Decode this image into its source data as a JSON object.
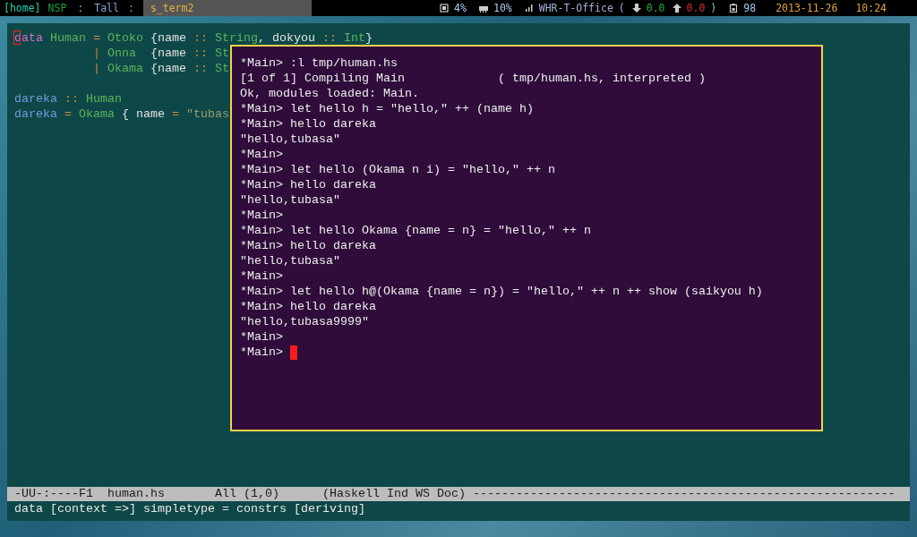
{
  "topbar": {
    "workspaces": [
      {
        "label": "[home]",
        "kind": "current"
      },
      {
        "label": "NSP",
        "kind": "hidden"
      }
    ],
    "separator_1": ":",
    "layout": "Tall",
    "separator_2": ":",
    "window_title": "s_term2",
    "status": [
      {
        "kind": "cpu",
        "text": "4%"
      },
      {
        "kind": "memory",
        "text": "10%"
      },
      {
        "kind": "wifi",
        "text": "WHR-T-Office"
      },
      {
        "kind": "paren",
        "text": "("
      },
      {
        "kind": "down",
        "text": "0.0"
      },
      {
        "kind": "up",
        "text": "0.0"
      },
      {
        "kind": "paren",
        "text": ")"
      },
      {
        "kind": "battery",
        "text": "98"
      },
      {
        "kind": "date",
        "text": "2013-11-26"
      },
      {
        "kind": "time",
        "text": "10:24"
      }
    ]
  },
  "editor": {
    "cursor_visible": true,
    "lines": [
      [
        {
          "text": "data",
          "kind": "keyword"
        },
        {
          "text": " Human",
          "kind": "type"
        },
        {
          "text": " =",
          "kind": "op"
        },
        {
          "text": " Otoko",
          "kind": "type"
        },
        {
          "text": " {name",
          "kind": "plain"
        },
        {
          "text": " ::",
          "kind": "op"
        },
        {
          "text": " String",
          "kind": "type"
        },
        {
          "text": ", dokyou",
          "kind": "plain"
        },
        {
          "text": " ::",
          "kind": "op"
        },
        {
          "text": " Int",
          "kind": "type"
        },
        {
          "text": "}",
          "kind": "plain"
        }
      ],
      [
        {
          "text": "           |",
          "kind": "op"
        },
        {
          "text": " Onna",
          "kind": "type"
        },
        {
          "text": "  {name",
          "kind": "plain"
        },
        {
          "text": " ::",
          "kind": "op"
        },
        {
          "text": " St",
          "kind": "type"
        }
      ],
      [
        {
          "text": "           |",
          "kind": "op"
        },
        {
          "text": " Okama",
          "kind": "type"
        },
        {
          "text": " {name",
          "kind": "plain"
        },
        {
          "text": " ::",
          "kind": "op"
        },
        {
          "text": " St",
          "kind": "type"
        }
      ],
      [
        {
          "text": "dareka",
          "kind": "func",
          "gap_before": true
        },
        {
          "text": " ::",
          "kind": "op"
        },
        {
          "text": " Human",
          "kind": "type"
        }
      ],
      [
        {
          "text": "dareka",
          "kind": "func"
        },
        {
          "text": " =",
          "kind": "op"
        },
        {
          "text": " Okama",
          "kind": "type"
        },
        {
          "text": " { name",
          "kind": "plain"
        },
        {
          "text": " =",
          "kind": "op"
        },
        {
          "text": " \"tubas",
          "kind": "string"
        }
      ]
    ]
  },
  "terminal": {
    "cursor_visible": true,
    "lines": [
      "*Main> :l tmp/human.hs",
      "[1 of 1] Compiling Main             ( tmp/human.hs, interpreted )",
      "Ok, modules loaded: Main.",
      "*Main> let hello h = \"hello,\" ++ (name h)",
      "*Main> hello dareka",
      "\"hello,tubasa\"",
      "*Main>",
      "*Main> let hello (Okama n i) = \"hello,\" ++ n",
      "*Main> hello dareka",
      "\"hello,tubasa\"",
      "*Main>",
      "*Main> let hello Okama {name = n} = \"hello,\" ++ n",
      "*Main> hello dareka",
      "\"hello,tubasa\"",
      "*Main>",
      "*Main> let hello h@(Okama {name = n}) = \"hello,\" ++ n ++ show (saikyou h)",
      "*Main> hello dareka",
      "\"hello,tubasa9999\"",
      "*Main>",
      "*Main>"
    ]
  },
  "modeline": {
    "status": "-UU-:----F1",
    "buffer": "human.hs",
    "position": "All (1,0)",
    "mode": "(Haskell Ind WS Doc)",
    "fill": "-----------------------------------------------------------"
  },
  "minibuffer": "data [context =>] simpletype = constrs [deriving]"
}
